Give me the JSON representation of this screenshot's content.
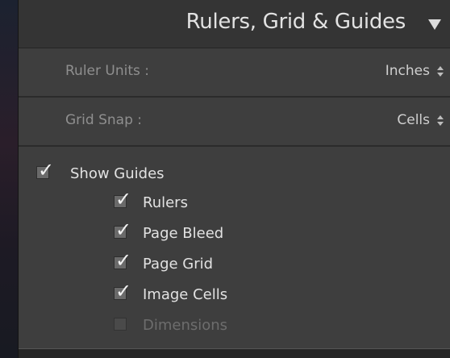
{
  "panel": {
    "title": "Rulers, Grid & Guides",
    "collapse_icon": "triangle-down-icon"
  },
  "ruler_units": {
    "label": "Ruler Units :",
    "value": "Inches"
  },
  "grid_snap": {
    "label": "Grid Snap :",
    "value": "Cells"
  },
  "guides": {
    "show_guides": {
      "label": "Show Guides",
      "checked": true
    },
    "items": [
      {
        "label": "Rulers",
        "checked": true,
        "enabled": true
      },
      {
        "label": "Page Bleed",
        "checked": true,
        "enabled": true
      },
      {
        "label": "Page Grid",
        "checked": true,
        "enabled": true
      },
      {
        "label": "Image Cells",
        "checked": true,
        "enabled": true
      },
      {
        "label": "Dimensions",
        "checked": false,
        "enabled": false
      }
    ]
  },
  "colors": {
    "panel_bg": "#3e3e3e",
    "header_bg": "#343434",
    "text_light": "#e2e2e2",
    "text_muted": "#8f8f8f",
    "text_disabled": "#6d6d6d"
  }
}
